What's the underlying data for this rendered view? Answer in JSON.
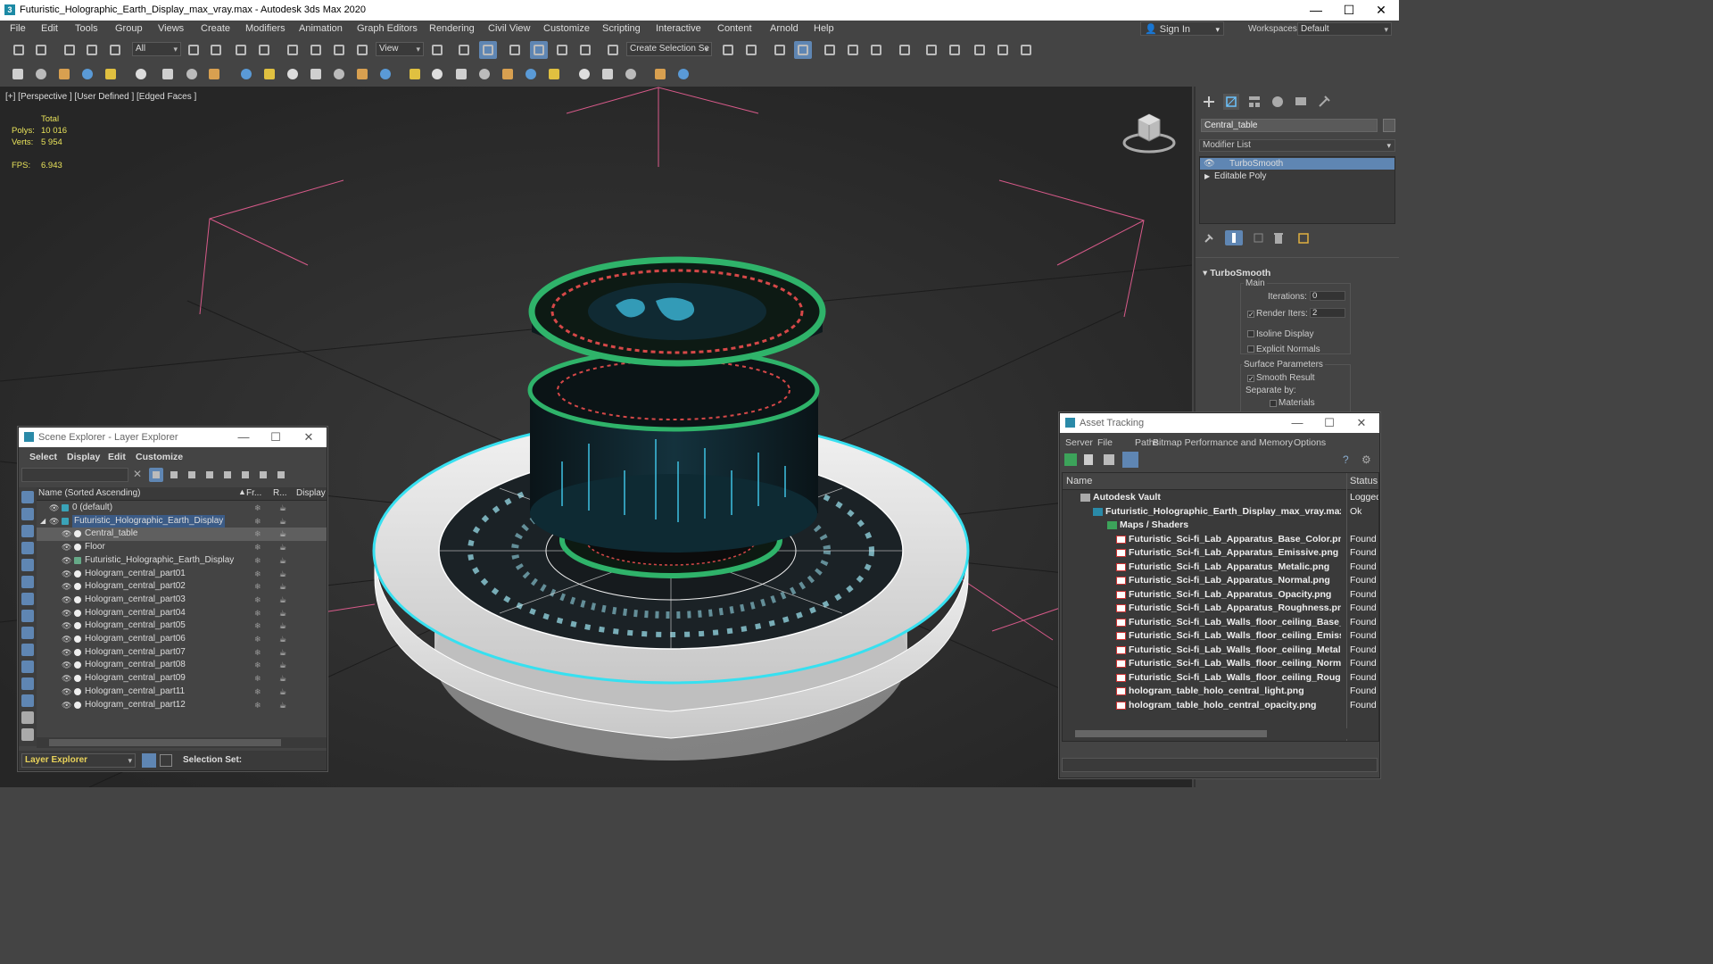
{
  "window": {
    "title": "Futuristic_Holographic_Earth_Display_max_vray.max - Autodesk 3ds Max 2020",
    "app_icon": "3"
  },
  "menu": [
    "File",
    "Edit",
    "Tools",
    "Group",
    "Views",
    "Create",
    "Modifiers",
    "Animation",
    "Graph Editors",
    "Rendering",
    "Civil View",
    "Customize",
    "Scripting",
    "Interactive",
    "Content",
    "Arnold",
    "Help"
  ],
  "account": {
    "sign_in": "Sign In",
    "workspaces_label": "Workspaces:",
    "workspace": "Default"
  },
  "toolbar": {
    "filter": "All",
    "ref_coord": "View",
    "selection_set": "Create Selection Se"
  },
  "viewport": {
    "label": "[+] [Perspective ] [User Defined ] [Edged Faces ]",
    "stats": {
      "total_label": "Total",
      "polys_label": "Polys:",
      "polys": "10 016",
      "verts_label": "Verts:",
      "verts": "5 954",
      "fps_label": "FPS:",
      "fps": "6.943"
    }
  },
  "command_panel": {
    "object_name": "Central_table",
    "modifier_list": "Modifier List",
    "stack": [
      "TurboSmooth",
      "Editable Poly"
    ],
    "rollout": "TurboSmooth",
    "main_label": "Main",
    "iterations_label": "Iterations:",
    "iterations": "0",
    "render_iters_label": "Render Iters:",
    "render_iters": "2",
    "isoline": "Isoline Display",
    "explicit_normals": "Explicit Normals",
    "surface_params": "Surface Parameters",
    "smooth_result": "Smooth Result",
    "separate_by": "Separate by:",
    "materials": "Materials"
  },
  "scene_explorer": {
    "title": "Scene Explorer - Layer Explorer",
    "menu": [
      "Select",
      "Display",
      "Edit",
      "Customize"
    ],
    "columns": {
      "name": "Name (Sorted Ascending)",
      "fr": "Fr...",
      "r": "R...",
      "display": "Display as Bo:"
    },
    "rows": [
      {
        "name": "0 (default)",
        "level": 1,
        "kind": "layer"
      },
      {
        "name": "Futuristic_Holographic_Earth_Display",
        "level": 1,
        "kind": "layer"
      },
      {
        "name": "Central_table",
        "level": 2,
        "kind": "obj"
      },
      {
        "name": "Floor",
        "level": 2,
        "kind": "obj"
      },
      {
        "name": "Futuristic_Holographic_Earth_Display",
        "level": 2,
        "kind": "group"
      },
      {
        "name": "Hologram_central_part01",
        "level": 2,
        "kind": "obj"
      },
      {
        "name": "Hologram_central_part02",
        "level": 2,
        "kind": "obj"
      },
      {
        "name": "Hologram_central_part03",
        "level": 2,
        "kind": "obj"
      },
      {
        "name": "Hologram_central_part04",
        "level": 2,
        "kind": "obj"
      },
      {
        "name": "Hologram_central_part05",
        "level": 2,
        "kind": "obj"
      },
      {
        "name": "Hologram_central_part06",
        "level": 2,
        "kind": "obj"
      },
      {
        "name": "Hologram_central_part07",
        "level": 2,
        "kind": "obj"
      },
      {
        "name": "Hologram_central_part08",
        "level": 2,
        "kind": "obj"
      },
      {
        "name": "Hologram_central_part09",
        "level": 2,
        "kind": "obj"
      },
      {
        "name": "Hologram_central_part11",
        "level": 2,
        "kind": "obj"
      },
      {
        "name": "Hologram_central_part12",
        "level": 2,
        "kind": "obj"
      }
    ],
    "footer_explorer": "Layer Explorer",
    "footer_selset": "Selection Set:"
  },
  "asset_tracking": {
    "title": "Asset Tracking",
    "menu": [
      "Server",
      "File",
      "Paths",
      "Bitmap Performance and Memory",
      "Options"
    ],
    "columns": {
      "name": "Name",
      "status": "Status"
    },
    "rows": [
      {
        "name": "Autodesk Vault",
        "status": "Logged",
        "level": 0,
        "kind": "vault"
      },
      {
        "name": "Futuristic_Holographic_Earth_Display_max_vray.max",
        "status": "Ok",
        "level": 1,
        "kind": "max"
      },
      {
        "name": "Maps / Shaders",
        "status": "",
        "level": 2,
        "kind": "folder"
      },
      {
        "name": "Futuristic_Sci-fi_Lab_Apparatus_Base_Color.png",
        "status": "Found",
        "level": 3,
        "kind": "png"
      },
      {
        "name": "Futuristic_Sci-fi_Lab_Apparatus_Emissive.png",
        "status": "Found",
        "level": 3,
        "kind": "png"
      },
      {
        "name": "Futuristic_Sci-fi_Lab_Apparatus_Metalic.png",
        "status": "Found",
        "level": 3,
        "kind": "png"
      },
      {
        "name": "Futuristic_Sci-fi_Lab_Apparatus_Normal.png",
        "status": "Found",
        "level": 3,
        "kind": "png"
      },
      {
        "name": "Futuristic_Sci-fi_Lab_Apparatus_Opacity.png",
        "status": "Found",
        "level": 3,
        "kind": "png"
      },
      {
        "name": "Futuristic_Sci-fi_Lab_Apparatus_Roughness.png",
        "status": "Found",
        "level": 3,
        "kind": "png"
      },
      {
        "name": "Futuristic_Sci-fi_Lab_Walls_floor_ceiling_Base_Color.png",
        "status": "Found",
        "level": 3,
        "kind": "png"
      },
      {
        "name": "Futuristic_Sci-fi_Lab_Walls_floor_ceiling_Emissive.png",
        "status": "Found",
        "level": 3,
        "kind": "png"
      },
      {
        "name": "Futuristic_Sci-fi_Lab_Walls_floor_ceiling_Metalic.png",
        "status": "Found",
        "level": 3,
        "kind": "png"
      },
      {
        "name": "Futuristic_Sci-fi_Lab_Walls_floor_ceiling_Normal.png",
        "status": "Found",
        "level": 3,
        "kind": "png"
      },
      {
        "name": "Futuristic_Sci-fi_Lab_Walls_floor_ceiling_Roughness.png",
        "status": "Found",
        "level": 3,
        "kind": "png"
      },
      {
        "name": "hologram_table_holo_central_light.png",
        "status": "Found",
        "level": 3,
        "kind": "png"
      },
      {
        "name": "hologram_table_holo_central_opacity.png",
        "status": "Found",
        "level": 3,
        "kind": "png"
      }
    ]
  },
  "colors": {
    "accent": "#5f86b3",
    "selection_wire": "#37e0f0",
    "stat_text": "#e8e25a",
    "grid_red": "#d85a8a"
  }
}
